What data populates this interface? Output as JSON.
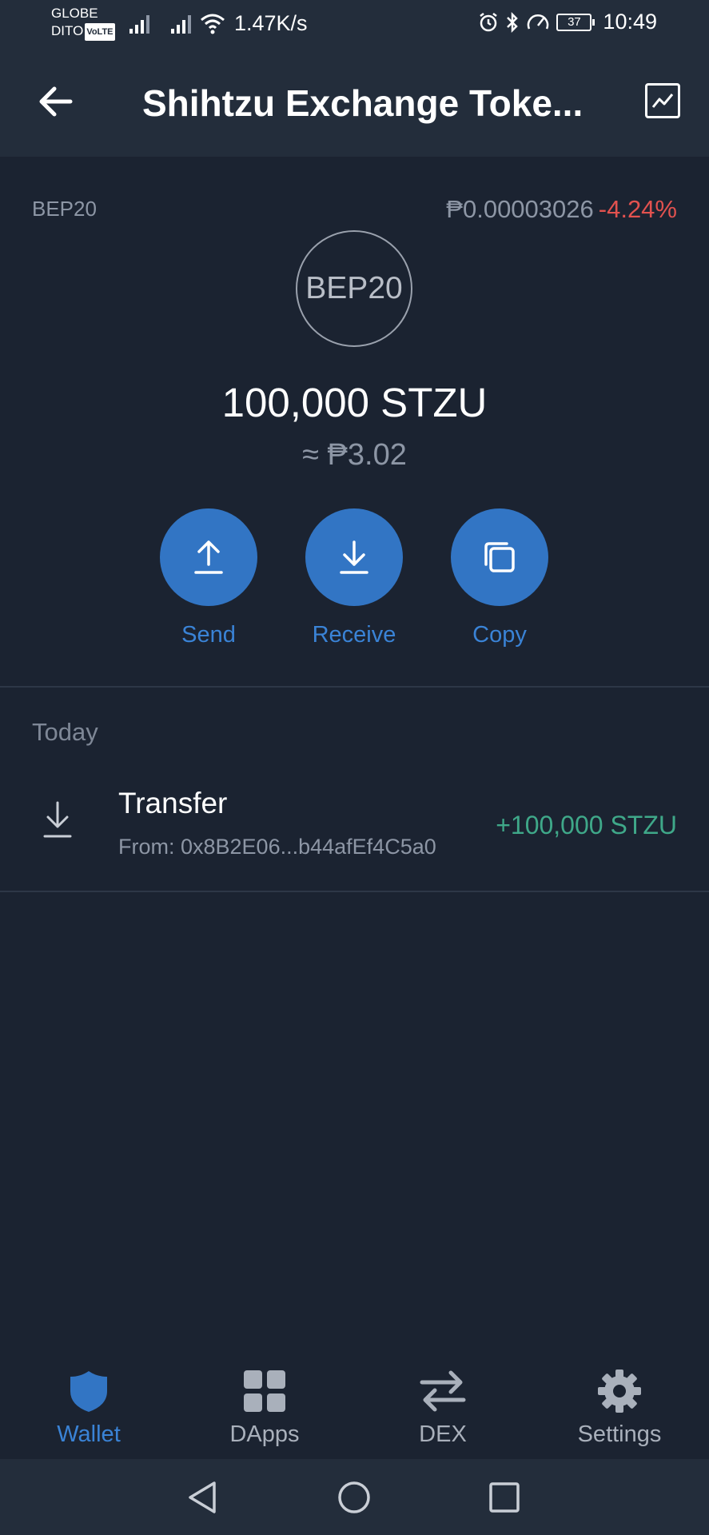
{
  "status_bar": {
    "carrier_line1": "GLOBE",
    "carrier_line2": "DITO",
    "volte": "VoLTE",
    "net_speed": "1.47K/s",
    "battery": "37",
    "time": "10:49"
  },
  "app_bar": {
    "title": "Shihtzu Exchange Toke..."
  },
  "token": {
    "network": "BEP20",
    "price": "₱0.00003026",
    "change": "-4.24%",
    "logo_text": "BEP20",
    "balance": "100,000 STZU",
    "fiat_value": "≈ ₱3.02"
  },
  "actions": {
    "send": "Send",
    "receive": "Receive",
    "copy": "Copy"
  },
  "history": {
    "section": "Today",
    "items": [
      {
        "title": "Transfer",
        "subtitle": "From: 0x8B2E06...b44afEf4C5a0",
        "amount": "+100,000 STZU"
      }
    ]
  },
  "bottom_nav": {
    "wallet": "Wallet",
    "dapps": "DApps",
    "dex": "DEX",
    "settings": "Settings",
    "active": "wallet"
  },
  "colors": {
    "background": "#1b2331",
    "bar": "#232d3b",
    "accent": "#3275c4",
    "negative": "#e2524f",
    "positive": "#3fa889"
  }
}
